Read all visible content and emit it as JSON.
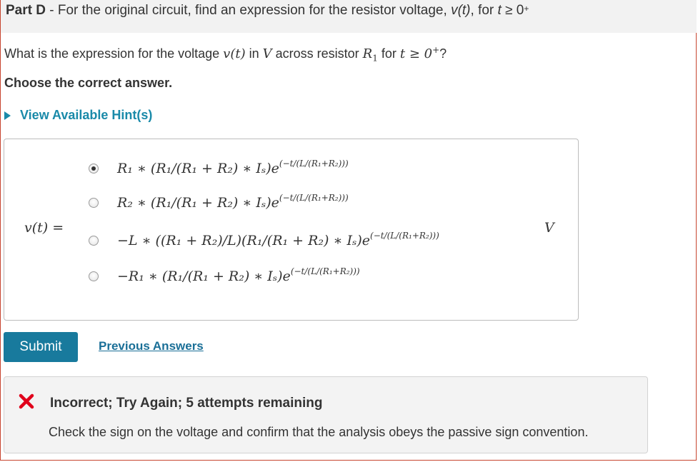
{
  "part": {
    "label": "Part D",
    "separator": " - ",
    "text_before": "For the original circuit, find an expression for the resistor voltage, ",
    "vt": "v(t)",
    "text_mid": ", for ",
    "t": "t",
    "cond": " ≥ 0",
    "sup": "+"
  },
  "question": {
    "text1": "What is the expression for the voltage ",
    "vt": "v(t)",
    "text2": " in ",
    "V": "V",
    "text3": " across resistor ",
    "R": "R",
    "R_sub": "1",
    "text4": " for ",
    "cond": "t ≥ 0",
    "cond_sup": "+",
    "text5": "?"
  },
  "instruction": "Choose the correct answer.",
  "hint_link": "View Available Hint(s)",
  "answer": {
    "lhs": "v(t) =",
    "unit": "V",
    "selected_index": 0,
    "choices": [
      {
        "main": "R₁ ∗ (R₁/(R₁ + R₂) ∗ Iₛ)e",
        "exp": "(−t/(L/(R₁+R₂)))"
      },
      {
        "main": "R₂ ∗ (R₁/(R₁ + R₂) ∗ Iₛ)e",
        "exp": "(−t/(L/(R₁+R₂)))"
      },
      {
        "main": "−L ∗ ((R₁ + R₂)/L)(R₁/(R₁ + R₂) ∗ Iₛ)e",
        "exp": "(−t/(L/(R₁+R₂)))"
      },
      {
        "main": "−R₁ ∗ (R₁/(R₁ + R₂) ∗ Iₛ)e",
        "exp": "(−t/(L/(R₁+R₂)))"
      }
    ]
  },
  "buttons": {
    "submit": "Submit",
    "previous_answers": "Previous Answers"
  },
  "feedback": {
    "icon": "x-icon",
    "icon_color": "#e0001b",
    "title": "Incorrect; Try Again; 5 attempts remaining",
    "message": "Check the sign on the voltage and confirm that the analysis obeys the passive sign convention."
  },
  "colors": {
    "accent": "#187a9d",
    "link": "#1a8aa9",
    "frame_border": "#c7442e"
  }
}
